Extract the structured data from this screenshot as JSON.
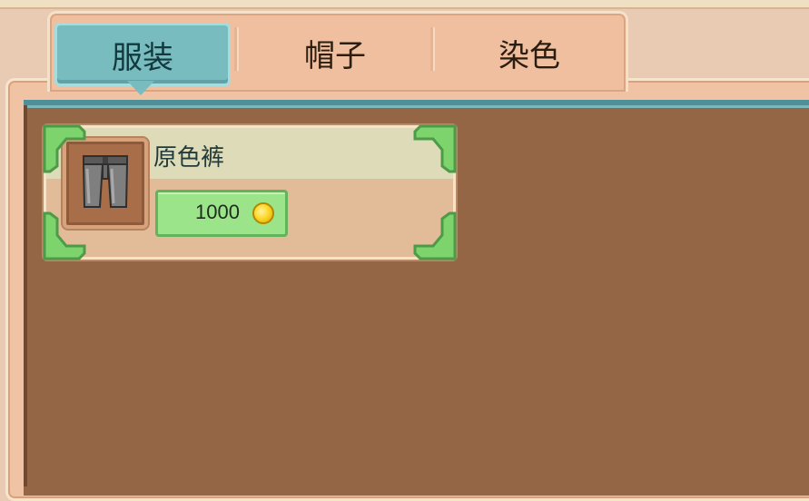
{
  "tabs": [
    {
      "label": "服装",
      "active": true
    },
    {
      "label": "帽子",
      "active": false
    },
    {
      "label": "染色",
      "active": false
    }
  ],
  "items": [
    {
      "name": "原色裤",
      "price": "1000",
      "currency_icon": "gold-coin-icon",
      "icon": "pants-icon"
    }
  ],
  "colors": {
    "active_tab": "#79bcc0",
    "panel_background": "#956645",
    "price_button": "#9be48a",
    "corner_accent": "#7dd36c"
  }
}
